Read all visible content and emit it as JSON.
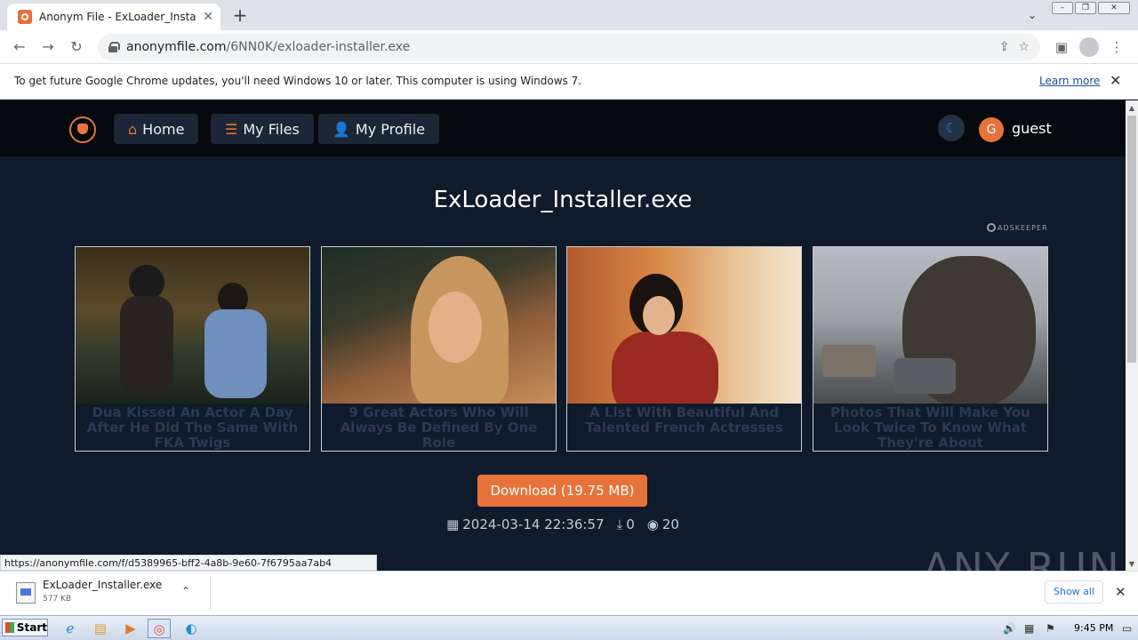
{
  "browser": {
    "tab_title": "Anonym File - ExLoader_Installer.exe",
    "new_tab": "+",
    "url_domain": "anonymfile.com",
    "url_path": "/6NN0K/exloader-installer.exe",
    "infobar_message": "To get future Google Chrome updates, you'll need Windows 10 or later. This computer is using Windows 7.",
    "infobar_link": "Learn more"
  },
  "site": {
    "nav": [
      {
        "icon": "home-icon",
        "label": "Home"
      },
      {
        "icon": "list-icon",
        "label": "My Files"
      },
      {
        "icon": "user-icon",
        "label": "My Profile"
      }
    ],
    "avatar_letter": "G",
    "username": "guest",
    "file_title": "ExLoader_Installer.exe",
    "ad_brand": "ADSKEEPER",
    "ads": [
      {
        "caption": "Dua Kissed An Actor A Day After He Did The Same With FKA Twigs"
      },
      {
        "caption": "9 Great Actors Who Will Always Be Defined By One Role"
      },
      {
        "caption": "A List With Beautiful And Talented French Actresses"
      },
      {
        "caption": "Photos That Will Make You Look Twice To Know What They're About"
      }
    ],
    "download_label": "Download (19.75 MB)",
    "meta": {
      "date": "2024-03-14 22:36:57",
      "downloads": "0",
      "views": "20"
    }
  },
  "status_url": "https://anonymfile.com/f/d5389965-bff2-4a8b-9e60-7f6795aa7ab4",
  "watermark": "ANY RUN",
  "download_shelf": {
    "file_name": "ExLoader_Installer.exe",
    "file_size": "577 KB",
    "show_all": "Show all"
  },
  "taskbar": {
    "start": "Start",
    "clock": "9:45 PM"
  },
  "colors": {
    "accent": "#e8733a",
    "page_bg": "#0f1a2b",
    "nav_bg": "#05080d"
  }
}
